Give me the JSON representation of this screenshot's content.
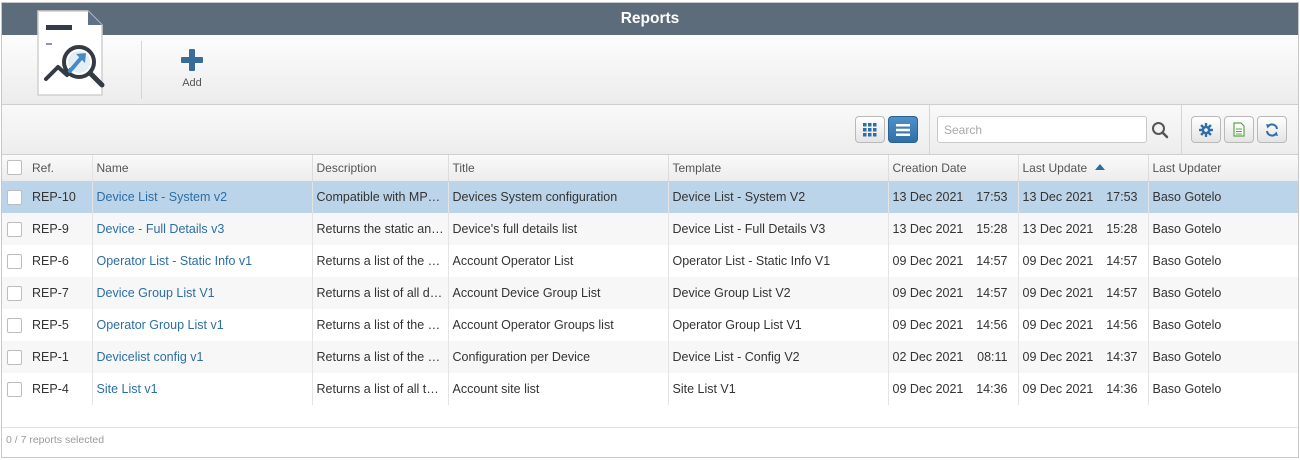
{
  "window": {
    "title": "Reports"
  },
  "toolbar": {
    "add_label": "Add",
    "report_icon": "report-analytics-icon"
  },
  "subbar": {
    "grid_view_icon": "grid-icon",
    "list_view_icon": "list-icon",
    "search_placeholder": "Search",
    "settings_icon": "gear-icon",
    "export_icon": "document-icon",
    "refresh_icon": "refresh-icon"
  },
  "colors": {
    "titlebar": "#5c6c7b",
    "accent": "#2c6ea4",
    "selected_row": "#bcd4ea"
  },
  "table": {
    "headers": {
      "ref": "Ref.",
      "name": "Name",
      "description": "Description",
      "title": "Title",
      "template": "Template",
      "creation_date": "Creation Date",
      "last_update": "Last Update",
      "last_updater": "Last Updater"
    },
    "rows": [
      {
        "ref": "REP-10",
        "name": "Device List - System v2",
        "description": "Compatible with MP…",
        "title": "Devices System configuration",
        "template": "Device List - System V2",
        "created_date": "13 Dec 2021",
        "created_time": "17:53",
        "updated_date": "13 Dec 2021",
        "updated_time": "17:53",
        "updater": "Baso Gotelo"
      },
      {
        "ref": "REP-9",
        "name": "Device - Full Details v3",
        "description": "Returns the static an…",
        "title": "Device's full details list",
        "template": "Device List - Full Details V3",
        "created_date": "13 Dec 2021",
        "created_time": "15:28",
        "updated_date": "13 Dec 2021",
        "updated_time": "15:28",
        "updater": "Baso Gotelo"
      },
      {
        "ref": "REP-6",
        "name": "Operator List - Static Info v1",
        "description": "Returns a list of the …",
        "title": "Account Operator List",
        "template": "Operator List - Static Info V1",
        "created_date": "09 Dec 2021",
        "created_time": "14:57",
        "updated_date": "09 Dec 2021",
        "updated_time": "14:57",
        "updater": "Baso Gotelo"
      },
      {
        "ref": "REP-7",
        "name": "Device Group List V1",
        "description": "Returns a list of all d…",
        "title": "Account Device Group List",
        "template": "Device Group List V2",
        "created_date": "09 Dec 2021",
        "created_time": "14:57",
        "updated_date": "09 Dec 2021",
        "updated_time": "14:57",
        "updater": "Baso Gotelo"
      },
      {
        "ref": "REP-5",
        "name": "Operator Group List v1",
        "description": "Returns a list of the …",
        "title": "Account Operator Groups list",
        "template": "Operator Group List V1",
        "created_date": "09 Dec 2021",
        "created_time": "14:56",
        "updated_date": "09 Dec 2021",
        "updated_time": "14:56",
        "updater": "Baso Gotelo"
      },
      {
        "ref": "REP-1",
        "name": "Devicelist config v1",
        "description": "Returns a list of the …",
        "title": "Configuration per Device",
        "template": "Device List - Config V2",
        "created_date": "02 Dec 2021",
        "created_time": "08:11",
        "updated_date": "09 Dec 2021",
        "updated_time": "14:37",
        "updater": "Baso Gotelo"
      },
      {
        "ref": "REP-4",
        "name": "Site List v1",
        "description": "Returns a list of all t…",
        "title": "Account site list",
        "template": "Site List V1",
        "created_date": "09 Dec 2021",
        "created_time": "14:36",
        "updated_date": "09 Dec 2021",
        "updated_time": "14:36",
        "updater": "Baso Gotelo"
      }
    ],
    "selected_index": 0,
    "sort": {
      "column": "last_update",
      "direction": "asc"
    }
  },
  "footer": {
    "status": "0 / 7 reports selected"
  }
}
